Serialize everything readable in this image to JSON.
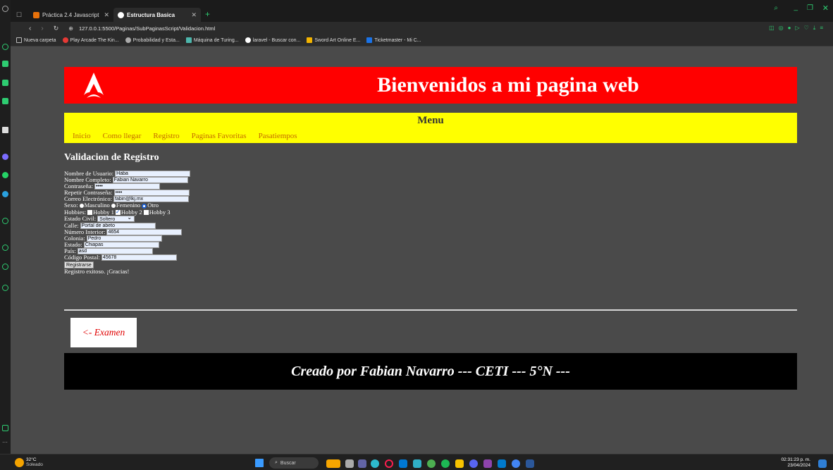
{
  "browser": {
    "tabs": [
      {
        "title": "Práctica 2.4 Javascript",
        "active": false
      },
      {
        "title": "Estructura Basica",
        "active": true
      }
    ],
    "url": "127.0.0.1:5500/Paginas/SubPaginasScript/Validacion.html",
    "bookmarks": [
      "Nueva carpeta",
      "Play Arcade The Kin...",
      "Probabilidad y Esta...",
      "Máquina de Turing...",
      "laravel - Buscar con...",
      "Sword Art Online E...",
      "Ticketmaster - Mi C..."
    ]
  },
  "page": {
    "header_title": "Bienvenidos a mi pagina web",
    "menu_title": "Menu",
    "menu_links": [
      "Inicio",
      "Como llegar",
      "Registro",
      "Paginas Favoritas",
      "Pasatiempos"
    ],
    "form_title": "Validacion de Registro",
    "fields": {
      "usuario": {
        "label": "Nombre de Usuario:",
        "value": "Haba"
      },
      "completo": {
        "label": "Nombre Completo:",
        "value": "Fabian Navarro"
      },
      "contrasena": {
        "label": "Contraseña:",
        "value": "••••"
      },
      "repetir": {
        "label": "Repetir Contraseña:",
        "value": "••••"
      },
      "correo": {
        "label": "Correo Electrónico:",
        "value": "fabin@lkj.mx"
      },
      "sexo": {
        "label": "Sexo:",
        "options": [
          "Masculino",
          "Femenino",
          "Otro"
        ],
        "selected": "Otro"
      },
      "hobbies": {
        "label": "Hobbies:",
        "options": [
          "Hobby 1",
          "Hobby 2",
          "Hobby 3"
        ],
        "checked": [
          "Hobby 2"
        ]
      },
      "estado_civil": {
        "label": "Estado Civil:",
        "value": "Soltero"
      },
      "calle": {
        "label": "Calle:",
        "value": "Portal de abeto"
      },
      "numero": {
        "label": "Número Interior:",
        "value": "4654"
      },
      "colonia": {
        "label": "Colonia:",
        "value": "Pedro"
      },
      "estado": {
        "label": "Estado:",
        "value": "Chiapas"
      },
      "pais": {
        "label": "País:",
        "value": "asd"
      },
      "cp": {
        "label": "Código Postal:",
        "value": "45678"
      }
    },
    "submit_label": "Registrarse",
    "success_message": "Registro exitoso. ¡Gracias!",
    "exam_link": "<- Examen",
    "footer": "Creado por Fabian Navarro --- CETI --- 5°N ---"
  },
  "taskbar": {
    "weather_temp": "32°C",
    "weather_text": "Soleado",
    "search_placeholder": "Buscar",
    "time": "02:31:23 p. m.",
    "date": "23/04/2024"
  },
  "colors": {
    "header": "#ff0000",
    "menu": "#ffff00",
    "page_bg": "#4a4a4a",
    "footer": "#000000"
  }
}
